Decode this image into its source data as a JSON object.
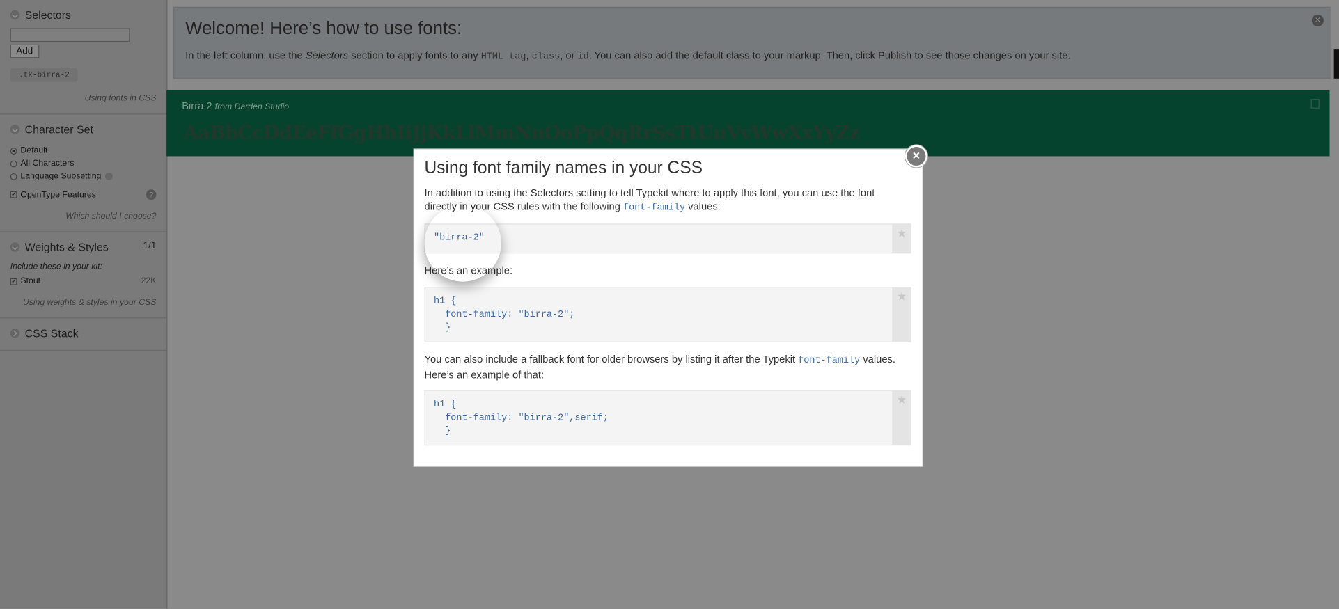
{
  "sidebar": {
    "selectors": {
      "title": "Selectors",
      "add_label": "Add",
      "tag": ".tk-birra-2",
      "help": "Using fonts in CSS"
    },
    "charset": {
      "title": "Character Set",
      "options": [
        "Default",
        "All Characters",
        "Language Subsetting"
      ],
      "opentype": "OpenType Features",
      "help": "Which should I choose?"
    },
    "weights": {
      "title": "Weights & Styles",
      "count": "1/1",
      "include": "Include these in your kit:",
      "item": "Stout",
      "size": "22K",
      "help": "Using weights & styles in your CSS"
    },
    "css_stack": {
      "title": "CSS Stack"
    }
  },
  "welcome": {
    "title": "Welcome! Here’s how to use fonts:",
    "text_1": "In the left column, use the ",
    "text_em": "Selectors",
    "text_2": " section to apply fonts to any ",
    "code_1": "HTML tag",
    "text_3": ", ",
    "code_2": "class",
    "text_4": ", or ",
    "code_3": "id",
    "text_5": ". You can also add the default class to your markup. Then, click Publish to see those changes on your site."
  },
  "font_band": {
    "name": "Birra 2",
    "from": "from Darden Studio",
    "sample": "AaBbCcDdEeFfGgHhIiJjKkLlMmNnOoPpQqRrSsTtUuVvWwXxYyZz"
  },
  "modal": {
    "title": "Using font family names in your CSS",
    "para1_a": "In addition to using the Selectors setting to tell Typekit where to apply this font, you can use the font directly in your CSS rules with the following ",
    "para1_code": "font-family",
    "para1_b": " values:",
    "code1": "\"birra-2\"",
    "para2": "Here’s an example:",
    "code2": "h1 {\n  font-family: \"birra-2\";\n  }",
    "para3_a": "You can also include a fallback font for older browsers by listing it after the Typekit ",
    "para3_code": "font-family",
    "para3_b": " values. Here’s an example of that:",
    "code3": "h1 {\n  font-family: \"birra-2\",serif;\n  }",
    "close": "×"
  }
}
